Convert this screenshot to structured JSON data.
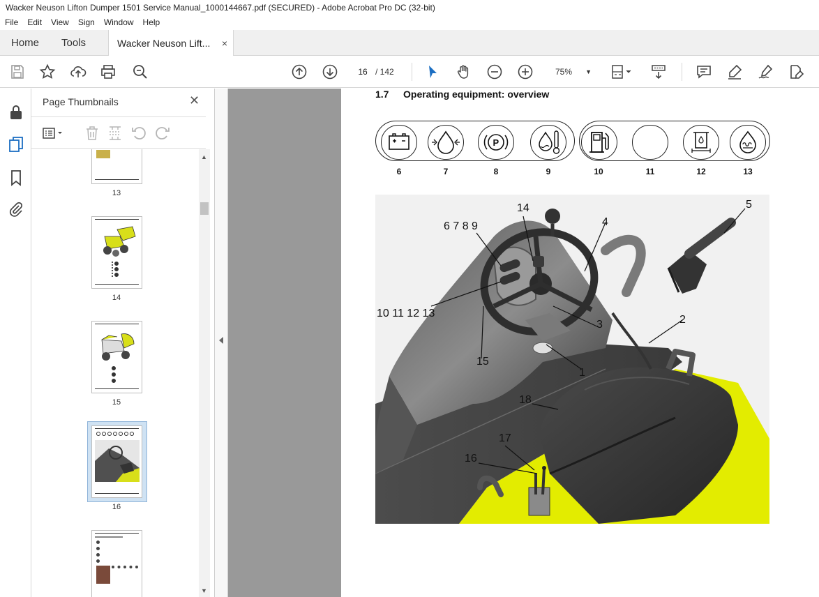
{
  "window": {
    "title": "Wacker Neuson Lifton Dumper 1501 Service Manual_1000144667.pdf (SECURED) - Adobe Acrobat Pro DC (32-bit)"
  },
  "menu": [
    "File",
    "Edit",
    "View",
    "Sign",
    "Window",
    "Help"
  ],
  "tabs": {
    "home": "Home",
    "tools": "Tools",
    "document": "Wacker Neuson Lift...",
    "close": "×"
  },
  "toolbar": {
    "current_page": "16",
    "total_pages": "/ 142",
    "zoom": "75%",
    "zoom_arrow": "▼"
  },
  "panel": {
    "title": "Page Thumbnails",
    "close": "✕",
    "thumbnails": [
      {
        "label": "13"
      },
      {
        "label": "14"
      },
      {
        "label": "15"
      },
      {
        "label": "16",
        "selected": true
      },
      {
        "label": ""
      }
    ]
  },
  "page": {
    "section_number": "1.7",
    "section_title": "Operating equipment: overview",
    "gauges": [
      {
        "label": "6",
        "icon": "battery-icon"
      },
      {
        "label": "7",
        "icon": "oil-pressure-icon"
      },
      {
        "label": "8",
        "icon": "parking-brake-icon"
      },
      {
        "label": "9",
        "icon": "coolant-temperature-icon"
      },
      {
        "label": "10",
        "icon": "fuel-icon"
      },
      {
        "label": "11",
        "icon": "blank-indicator-icon"
      },
      {
        "label": "12",
        "icon": "air-filter-icon"
      },
      {
        "label": "13",
        "icon": "glow-plug-icon"
      }
    ],
    "callouts": {
      "c14": "14",
      "c5": "5",
      "c6789": "6 7 8 9",
      "c4": "4",
      "c10111213": "10 11 12 13",
      "c3": "3",
      "c2": "2",
      "c15": "15",
      "c1": "1",
      "c18": "18",
      "c17": "17",
      "c16": "16"
    }
  },
  "colors": {
    "machine_yellow": "#e3ec00",
    "dark_grey": "#3e3e3e",
    "selection": "#cfe2f3"
  }
}
